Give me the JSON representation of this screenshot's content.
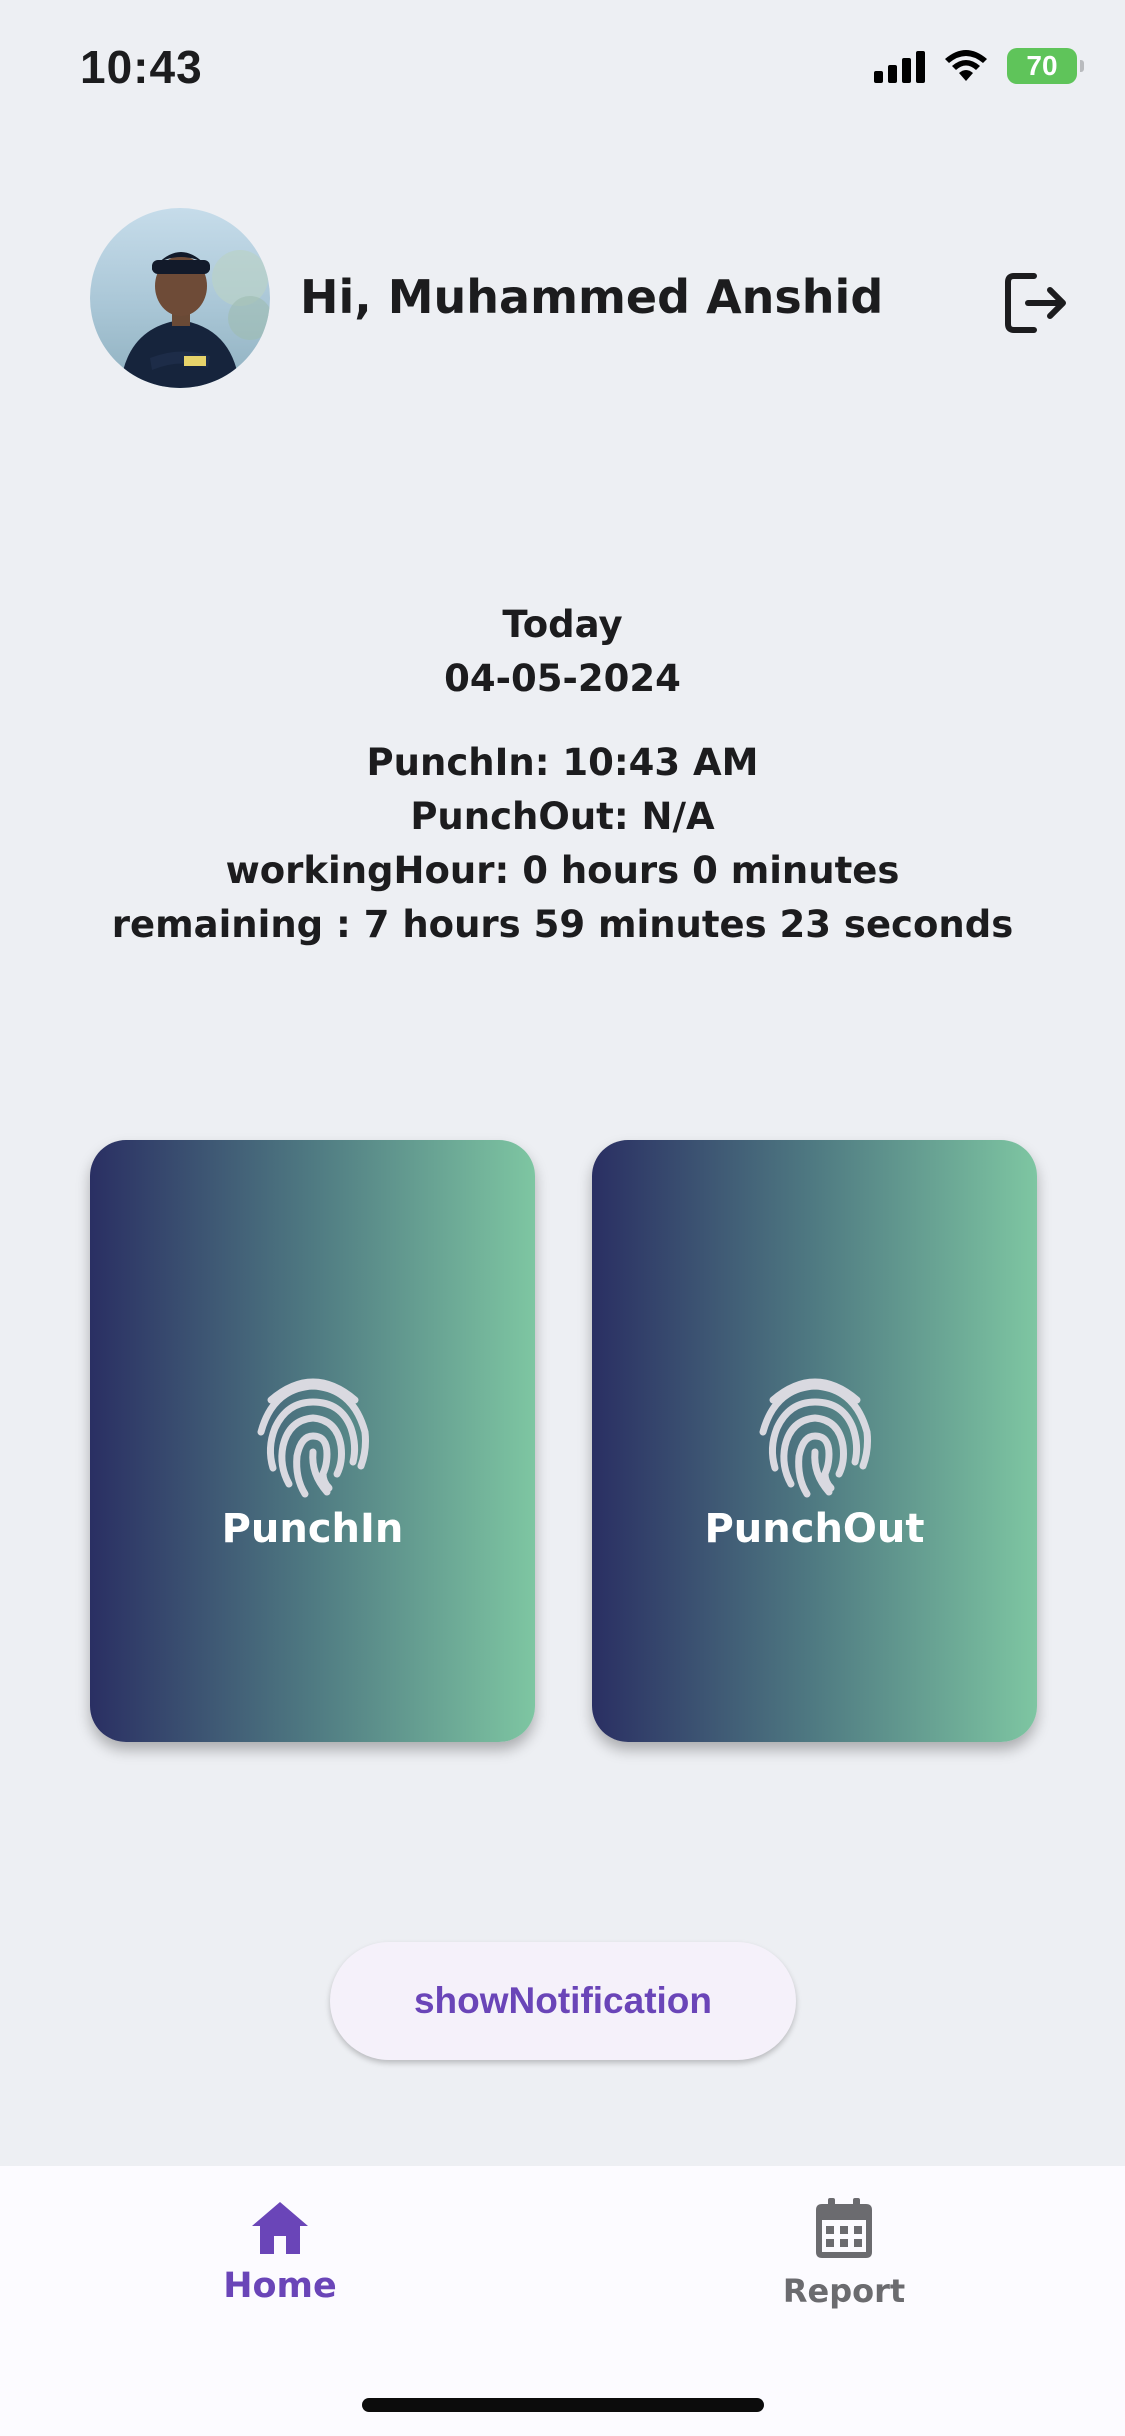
{
  "status_bar": {
    "time": "10:43",
    "battery": "70"
  },
  "header": {
    "greeting": "Hi, Muhammed Anshid"
  },
  "today": {
    "title": "Today",
    "date": "04-05-2024",
    "punch_in": "PunchIn: 10:43 AM",
    "punch_out": "PunchOut: N/A",
    "working_hour": "workingHour: 0 hours 0 minutes",
    "remaining": "remaining : 7 hours 59 minutes 23 seconds"
  },
  "cards": {
    "punch_in_label": "PunchIn",
    "punch_out_label": "PunchOut"
  },
  "notify_button": {
    "label": "showNotification"
  },
  "bottom_nav": {
    "home_label": "Home",
    "report_label": "Report"
  },
  "icons": {
    "logout": "logout-icon",
    "fingerprint": "fingerprint-icon",
    "home": "home-icon",
    "report": "calendar-icon"
  },
  "colors": {
    "accent": "#6a45b8",
    "card_gradient_start": "#2a2f63",
    "card_gradient_end": "#7ec6a2",
    "battery": "#5fc45a"
  }
}
